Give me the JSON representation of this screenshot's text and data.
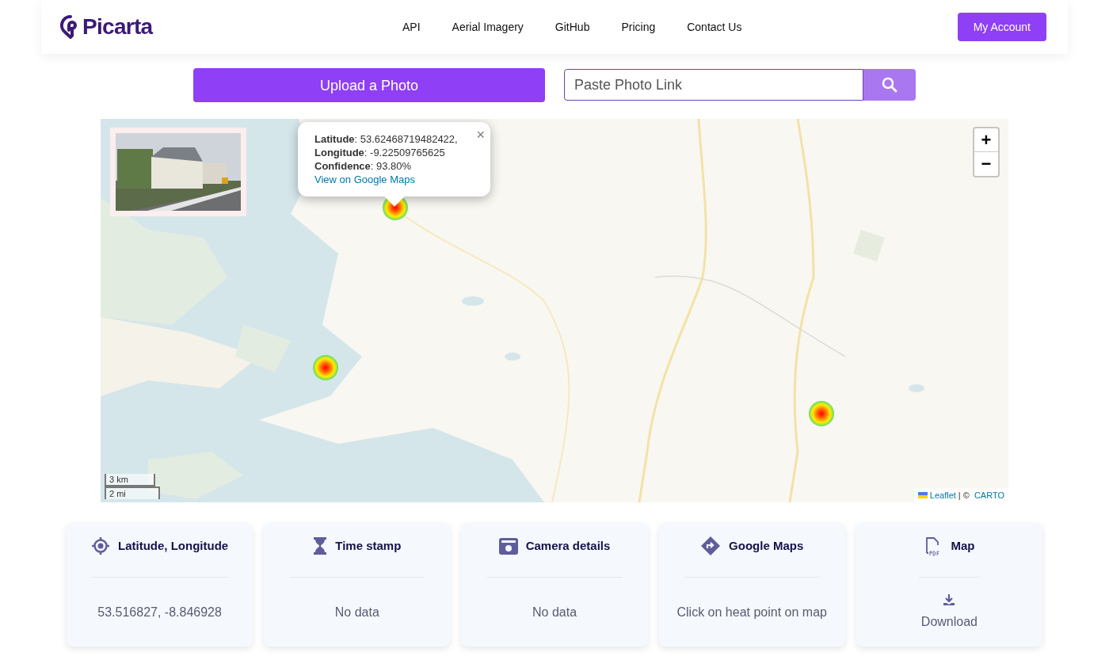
{
  "brand": {
    "name": "Picarta"
  },
  "nav": [
    "API",
    "Aerial Imagery",
    "GitHub",
    "Pricing",
    "Contact Us"
  ],
  "account_button": "My Account",
  "upload_button": "Upload a Photo",
  "link_field": {
    "placeholder": "Paste Photo Link"
  },
  "map": {
    "popup": {
      "lines": [
        "**Latitude**: 53.62468719482422,",
        "**Longitude**: -9.22509765625",
        "**Confidence**: 93.80%"
      ],
      "link": "View on Google Maps",
      "close": "×"
    },
    "zoom_in": "+",
    "zoom_out": "−",
    "scale": [
      "3 km",
      "2 mi"
    ],
    "attribution": {
      "link": "Leaflet",
      "rest": "| © ",
      "provider": "CARTO"
    }
  },
  "cards": [
    {
      "title": "Latitude, Longitude",
      "kind": "text",
      "value": "53.516827, -8.846928"
    },
    {
      "title": "Time stamp",
      "kind": "text",
      "value": "No data"
    },
    {
      "title": "Camera details",
      "kind": "text",
      "value": "No data"
    },
    {
      "title": "Google Maps",
      "kind": "text",
      "value": "Click on heat point on map"
    },
    {
      "title": "Map",
      "kind": "download",
      "value": "Download"
    }
  ]
}
